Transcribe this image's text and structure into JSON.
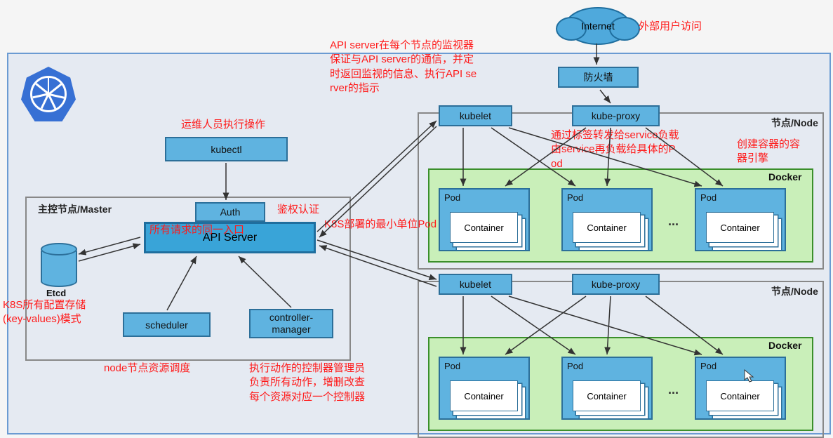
{
  "internet": "Internet",
  "firewall": "防火墙",
  "kubectl": "kubectl",
  "auth": "Auth",
  "api_server": "API Server",
  "etcd": "Etcd",
  "scheduler": "scheduler",
  "controller_manager": "controller-\nmanager",
  "kubelet": "kubelet",
  "kube_proxy": "kube-proxy",
  "pod": "Pod",
  "container": "Container",
  "docker": "Docker",
  "master_title": "主控节点/Master",
  "node_title": "节点/Node",
  "annotations": {
    "external": "外部用户访问",
    "ops": "运维人员执行操作",
    "kubelet_desc": "API server在每个节点的监视器\n保证与API server的通信，并定\n时返回监视的信息、执行API se\nrver的指示",
    "auth_desc": "鉴权认证",
    "api_desc": "所有请求的同一入口",
    "etcd_desc": "K8S所有配置存储\n(key-values)模式",
    "scheduler_desc": "node节点资源调度",
    "controller_desc": "执行动作的控制器管理员\n负责所有动作，增删改查\n每个资源对应一个控制器",
    "pod_desc": "K8S部署的最小单位Pod",
    "proxy_desc": "通过标签转发给service负载\n由service再负载给具体的P\nod",
    "docker_desc": "创建容器的容\n器引擎"
  }
}
